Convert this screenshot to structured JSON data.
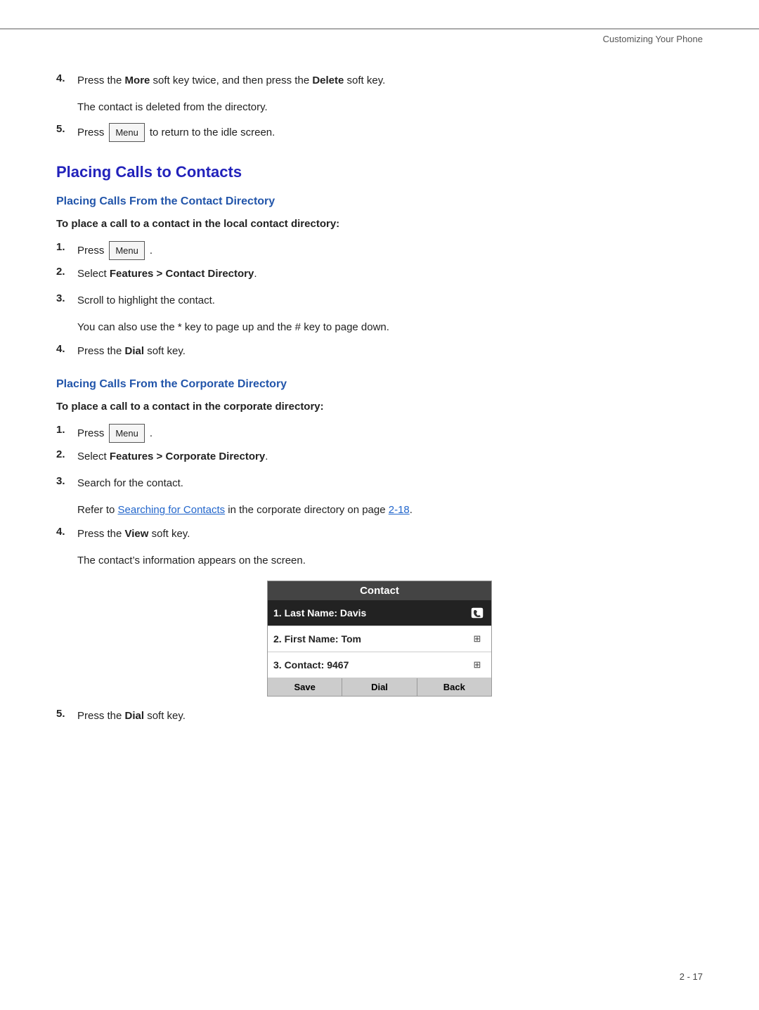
{
  "header": {
    "top_label": "Customizing Your Phone",
    "page_number": "2 - 17"
  },
  "top_steps": {
    "step4": {
      "number": "4.",
      "text_before": "Press the ",
      "bold1": "More",
      "text_middle1": " soft key twice, and then press the ",
      "bold2": "Delete",
      "text_after": " soft key.",
      "sub_text": "The contact is deleted from the directory."
    },
    "step5": {
      "number": "5.",
      "press_label": "Press",
      "menu_label": "Menu",
      "after_text": "to return to the idle screen."
    }
  },
  "section": {
    "title": "Placing Calls to Contacts",
    "sub1": {
      "heading": "Placing Calls From the Contact Directory",
      "instruction": "To place a call to a contact in the local contact directory:",
      "steps": [
        {
          "number": "1.",
          "type": "press_menu",
          "menu_label": "Menu"
        },
        {
          "number": "2.",
          "text": "Select ",
          "bold": "Features > Contact Directory",
          "after": "."
        },
        {
          "number": "3.",
          "text": "Scroll to highlight the contact.",
          "sub": "You can also use the * key to page up and the # key to page down."
        },
        {
          "number": "4.",
          "text": "Press the ",
          "bold": "Dial",
          "after": " soft key."
        }
      ]
    },
    "sub2": {
      "heading": "Placing Calls From the Corporate Directory",
      "instruction": "To place a call to a contact in the corporate directory:",
      "steps": [
        {
          "number": "1.",
          "type": "press_menu",
          "menu_label": "Menu"
        },
        {
          "number": "2.",
          "text": "Select ",
          "bold": "Features > Corporate Directory",
          "after": "."
        },
        {
          "number": "3.",
          "text": "Search for the contact.",
          "sub_before": "Refer to ",
          "sub_link": "Searching for Contacts",
          "sub_after": " in the corporate directory on page ",
          "sub_page": "2-18",
          "sub_end": "."
        },
        {
          "number": "4.",
          "text": "Press the ",
          "bold": "View",
          "after": " soft key.",
          "sub": "The contact’s information appears on the screen."
        }
      ],
      "contact_screen": {
        "header": "Contact",
        "rows": [
          {
            "text": "1. Last Name: Davis",
            "icon": "phone",
            "selected": true
          },
          {
            "text": "2. First Name: Tom",
            "icon": "grid",
            "selected": false
          },
          {
            "text": "3. Contact: 9467",
            "icon": "grid",
            "selected": false
          }
        ],
        "footer_buttons": [
          "Save",
          "Dial",
          "Back"
        ]
      },
      "step5": {
        "number": "5.",
        "text": "Press the ",
        "bold": "Dial",
        "after": " soft key."
      }
    }
  }
}
